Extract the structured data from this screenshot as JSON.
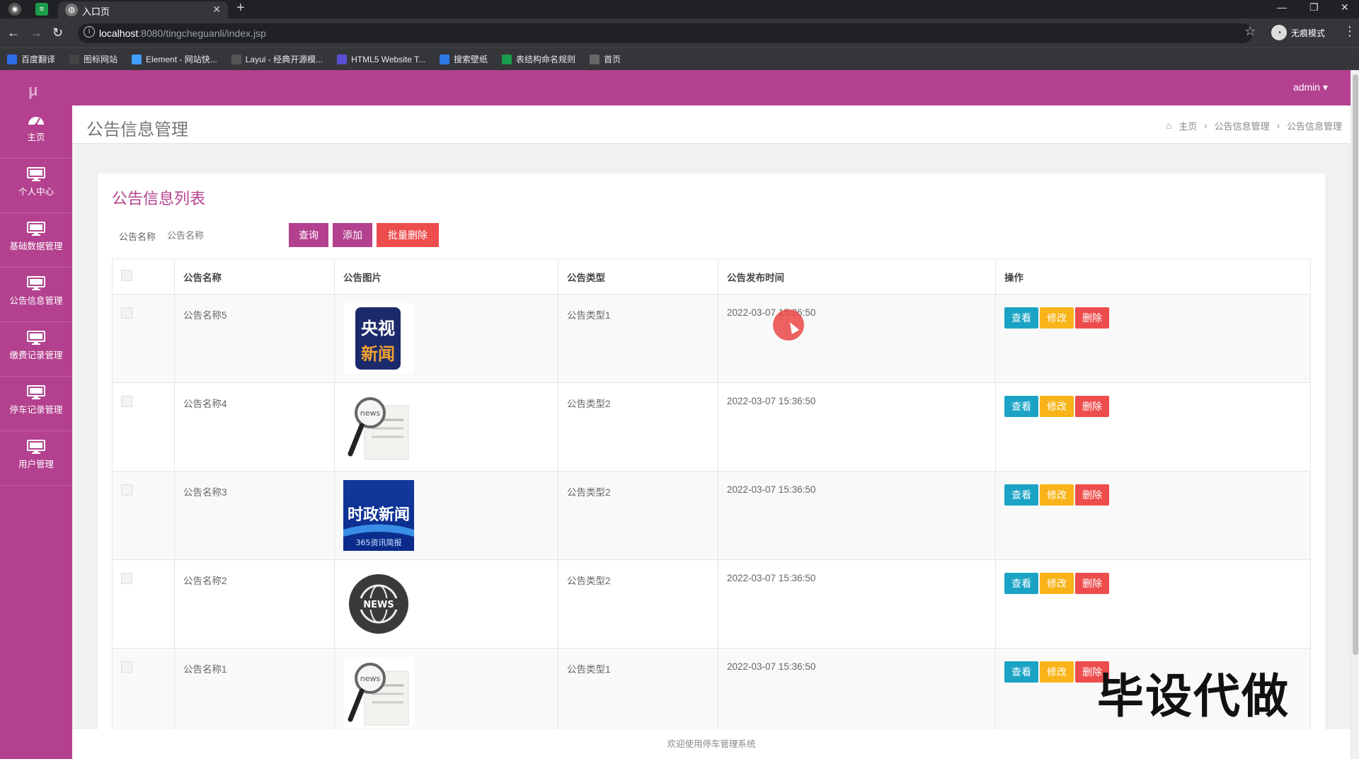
{
  "browser": {
    "tab_title": "入口页",
    "url_host": "localhost",
    "url_path": ":8080/tingcheguanli/index.jsp",
    "incognito_label": "无痕模式",
    "bookmarks": [
      {
        "label": "百度翻译",
        "icon": "translate-icon",
        "color": "#2b6de8"
      },
      {
        "label": "图标网站",
        "icon": "flag-icon",
        "color": "#444444"
      },
      {
        "label": "Element - 网站快...",
        "icon": "element-icon",
        "color": "#409eff"
      },
      {
        "label": "Layui - 经典开源模...",
        "icon": "layui-icon",
        "color": "#555555"
      },
      {
        "label": "HTML5 Website T...",
        "icon": "html5-icon",
        "color": "#5b4fd6"
      },
      {
        "label": "搜索壁纸",
        "icon": "wallpaper-icon",
        "color": "#2c7be5"
      },
      {
        "label": "表结构命名规则",
        "icon": "sheet-icon",
        "color": "#1a9c4a"
      },
      {
        "label": "首页",
        "icon": "globe-icon",
        "color": "#666666"
      }
    ]
  },
  "header": {
    "user": "admin ▾"
  },
  "sidebar": {
    "logo": "μ",
    "items": [
      {
        "label": "主页",
        "icon": "dashboard-icon"
      },
      {
        "label": "个人中心",
        "icon": "monitor-icon"
      },
      {
        "label": "基础数据管理",
        "icon": "monitor-icon"
      },
      {
        "label": "公告信息管理",
        "icon": "monitor-icon"
      },
      {
        "label": "缴费记录管理",
        "icon": "monitor-icon"
      },
      {
        "label": "停车记录管理",
        "icon": "monitor-icon"
      },
      {
        "label": "用户管理",
        "icon": "monitor-icon"
      }
    ]
  },
  "page": {
    "title": "公告信息管理",
    "breadcrumb": [
      "主页",
      "公告信息管理",
      "公告信息管理"
    ],
    "list_title": "公告信息列表",
    "search": {
      "label": "公告名称",
      "placeholder": "公告名称"
    },
    "buttons": {
      "query": "查询",
      "add": "添加",
      "batch_delete": "批量删除"
    },
    "columns": [
      "公告名称",
      "公告图片",
      "公告类型",
      "公告发布时间",
      "操作"
    ],
    "row_actions": {
      "view": "查看",
      "edit": "修改",
      "delete": "删除"
    },
    "rows": [
      {
        "name": "公告名称5",
        "image": "cctv-news-logo",
        "type": "公告类型1",
        "time": "2022-03-07 15:36:50"
      },
      {
        "name": "公告名称4",
        "image": "newspaper-magnifier",
        "type": "公告类型2",
        "time": "2022-03-07 15:36:50"
      },
      {
        "name": "公告名称3",
        "image": "political-news-banner",
        "type": "公告类型2",
        "time": "2022-03-07 15:36:50"
      },
      {
        "name": "公告名称2",
        "image": "news-globe-badge",
        "type": "公告类型2",
        "time": "2022-03-07 15:36:50"
      },
      {
        "name": "公告名称1",
        "image": "newspaper-magnifier",
        "type": "公告类型1",
        "time": "2022-03-07 15:36:50"
      }
    ],
    "thumb_text": {
      "cctv_top": "央视",
      "cctv_bottom": "新闻",
      "political": "时政新闻",
      "political_sub": "365资讯简报",
      "news": "NEWS",
      "paper": "news"
    }
  },
  "footer": {
    "text": "欢迎使用停车管理系统"
  },
  "watermark": "毕设代做",
  "colors": {
    "primary": "#b4418f",
    "danger": "#ee4d4d",
    "info": "#1ba3c5",
    "warning": "#f8b418"
  }
}
